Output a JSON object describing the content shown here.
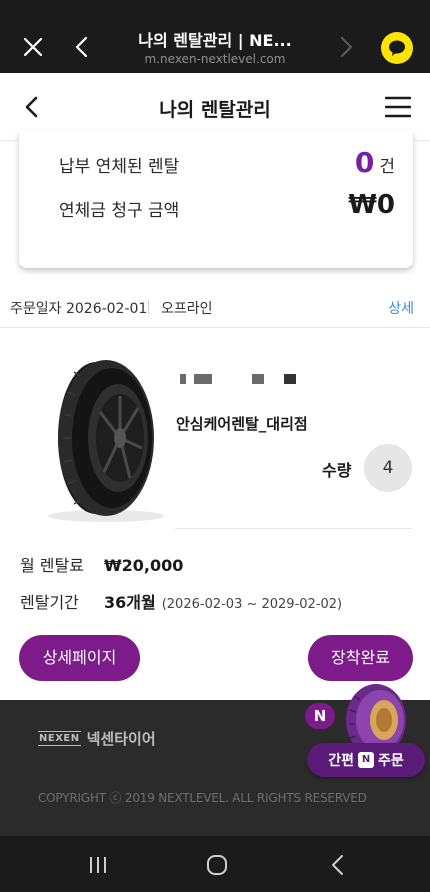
{
  "browser": {
    "title": "나의 렌탈관리 | NE...",
    "url": "m.nexen-nextlevel.com"
  },
  "header": {
    "title": "나의 렌탈관리"
  },
  "summary": {
    "overdue_label": "납부 연체된 렌탈",
    "overdue_count": "0",
    "overdue_unit": "건",
    "amount_label": "연체금 청구 금액",
    "amount_value": "₩0"
  },
  "order": {
    "date": "주문일자 2026-02-01",
    "channel": "오프라인",
    "detail_link": "상세"
  },
  "product": {
    "store": "안심케어렌탈_대리점",
    "qty_label": "수량",
    "qty_value": "4",
    "monthly_label": "월 렌탈료",
    "monthly_value": "₩20,000",
    "period_label": "렌탈기간",
    "period_value": "36개월",
    "period_range": "(2026-02-03 ~ 2029-02-02)"
  },
  "buttons": {
    "detail_page": "상세페이지",
    "install_done": "장착완료"
  },
  "footer": {
    "logo_mark": "NEXEN",
    "logo_text": "넥센타이어",
    "copyright": "COPYRIGHT ⓒ 2019 NEXTLEVEL. ALL RIGHTS RESERVED"
  },
  "quick_order": {
    "badge": "N",
    "label_left": "간편",
    "label_right": "주문"
  },
  "colors": {
    "accent": "#7d1b8a",
    "link": "#3d8fd1",
    "kakao": "#fee500"
  }
}
